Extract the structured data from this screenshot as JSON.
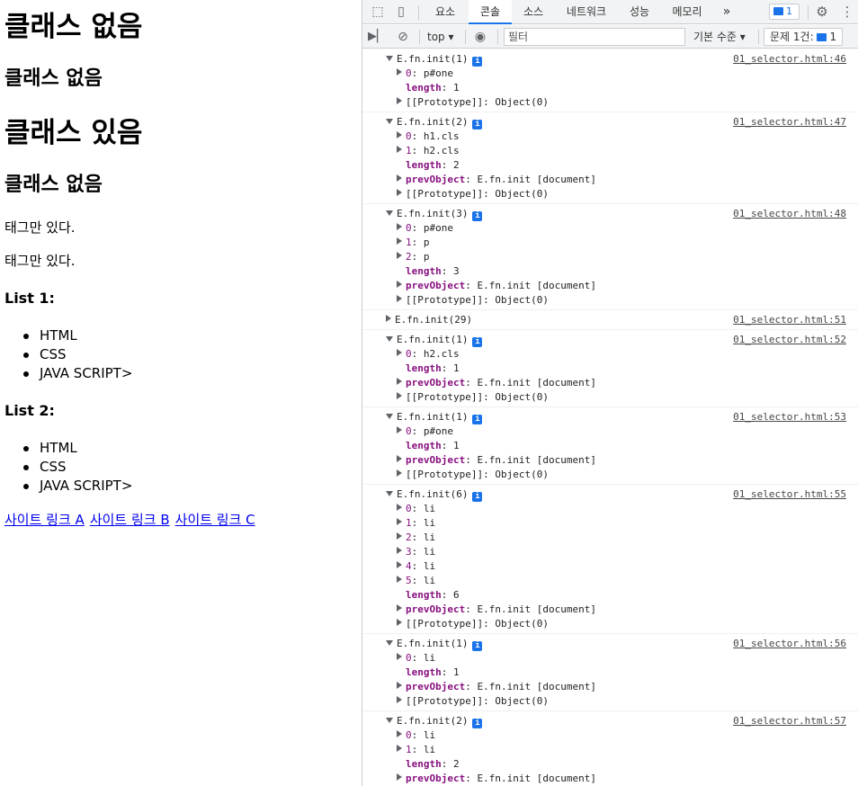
{
  "page": {
    "h1_first": "클래스 없음",
    "h2_first": "클래스 없음",
    "h1_second": "클래스 있음",
    "h2_second": "클래스 없음",
    "p_first": "태그만 있다.",
    "p_second": "태그만 있다.",
    "list1_title": "List 1:",
    "list1": [
      "HTML",
      "CSS",
      "JAVA SCRIPT>"
    ],
    "list2_title": "List 2:",
    "list2": [
      "HTML",
      "CSS",
      "JAVA SCRIPT>"
    ],
    "links": [
      "사이트 링크 A",
      "사이트 링크 B",
      "사이트 링크 C"
    ]
  },
  "devtools": {
    "tabs": [
      "요소",
      "콘솔",
      "소스",
      "네트워크",
      "성능",
      "메모리"
    ],
    "more_tabs": "»",
    "issue_count": "1",
    "context": "top ▾",
    "filter_placeholder": "필터",
    "level": "기본 수준 ▾",
    "issues_label": "문제 1건:",
    "issues_count": "1"
  },
  "console": [
    {
      "head": "E.fn.init(1)",
      "expanded": true,
      "src": "01_selector.html:46",
      "children": [
        {
          "key": "0",
          "val": "p#one",
          "kind": "child"
        },
        {
          "key": "length",
          "val": "1",
          "kind": "leaf"
        },
        {
          "key": "[[Prototype]]",
          "val": "Object(0)",
          "kind": "proto"
        }
      ]
    },
    {
      "head": "E.fn.init(2)",
      "expanded": true,
      "src": "01_selector.html:47",
      "children": [
        {
          "key": "0",
          "val": "h1.cls",
          "kind": "child"
        },
        {
          "key": "1",
          "val": "h2.cls",
          "kind": "child"
        },
        {
          "key": "length",
          "val": "2",
          "kind": "leaf"
        },
        {
          "key": "prevObject",
          "val": "E.fn.init [document]",
          "kind": "child"
        },
        {
          "key": "[[Prototype]]",
          "val": "Object(0)",
          "kind": "proto"
        }
      ]
    },
    {
      "head": "E.fn.init(3)",
      "expanded": true,
      "src": "01_selector.html:48",
      "children": [
        {
          "key": "0",
          "val": "p#one",
          "kind": "child"
        },
        {
          "key": "1",
          "val": "p",
          "kind": "child"
        },
        {
          "key": "2",
          "val": "p",
          "kind": "child"
        },
        {
          "key": "length",
          "val": "3",
          "kind": "leaf"
        },
        {
          "key": "prevObject",
          "val": "E.fn.init [document]",
          "kind": "child"
        },
        {
          "key": "[[Prototype]]",
          "val": "Object(0)",
          "kind": "proto"
        }
      ]
    },
    {
      "head": "E.fn.init(29)",
      "expanded": false,
      "src": "01_selector.html:51",
      "children": []
    },
    {
      "head": "E.fn.init(1)",
      "expanded": true,
      "src": "01_selector.html:52",
      "children": [
        {
          "key": "0",
          "val": "h2.cls",
          "kind": "child"
        },
        {
          "key": "length",
          "val": "1",
          "kind": "leaf"
        },
        {
          "key": "prevObject",
          "val": "E.fn.init [document]",
          "kind": "child"
        },
        {
          "key": "[[Prototype]]",
          "val": "Object(0)",
          "kind": "proto"
        }
      ]
    },
    {
      "head": "E.fn.init(1)",
      "expanded": true,
      "src": "01_selector.html:53",
      "children": [
        {
          "key": "0",
          "val": "p#one",
          "kind": "child"
        },
        {
          "key": "length",
          "val": "1",
          "kind": "leaf"
        },
        {
          "key": "prevObject",
          "val": "E.fn.init [document]",
          "kind": "child"
        },
        {
          "key": "[[Prototype]]",
          "val": "Object(0)",
          "kind": "proto"
        }
      ]
    },
    {
      "head": "E.fn.init(6)",
      "expanded": true,
      "src": "01_selector.html:55",
      "children": [
        {
          "key": "0",
          "val": "li",
          "kind": "child"
        },
        {
          "key": "1",
          "val": "li",
          "kind": "child"
        },
        {
          "key": "2",
          "val": "li",
          "kind": "child"
        },
        {
          "key": "3",
          "val": "li",
          "kind": "child"
        },
        {
          "key": "4",
          "val": "li",
          "kind": "child"
        },
        {
          "key": "5",
          "val": "li",
          "kind": "child"
        },
        {
          "key": "length",
          "val": "6",
          "kind": "leaf"
        },
        {
          "key": "prevObject",
          "val": "E.fn.init [document]",
          "kind": "child"
        },
        {
          "key": "[[Prototype]]",
          "val": "Object(0)",
          "kind": "proto"
        }
      ]
    },
    {
      "head": "E.fn.init(1)",
      "expanded": true,
      "src": "01_selector.html:56",
      "children": [
        {
          "key": "0",
          "val": "li",
          "kind": "child"
        },
        {
          "key": "length",
          "val": "1",
          "kind": "leaf"
        },
        {
          "key": "prevObject",
          "val": "E.fn.init [document]",
          "kind": "child"
        },
        {
          "key": "[[Prototype]]",
          "val": "Object(0)",
          "kind": "proto"
        }
      ]
    },
    {
      "head": "E.fn.init(2)",
      "expanded": true,
      "src": "01_selector.html:57",
      "children": [
        {
          "key": "0",
          "val": "li",
          "kind": "child"
        },
        {
          "key": "1",
          "val": "li",
          "kind": "child"
        },
        {
          "key": "length",
          "val": "2",
          "kind": "leaf"
        },
        {
          "key": "prevObject",
          "val": "E.fn.init [document]",
          "kind": "child"
        }
      ]
    }
  ]
}
